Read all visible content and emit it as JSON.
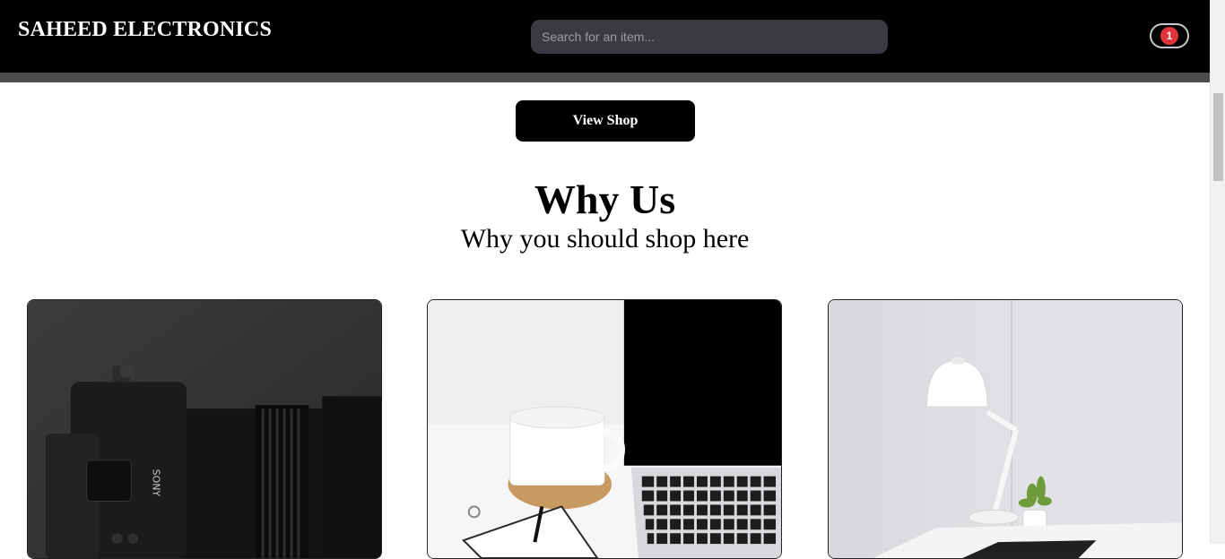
{
  "header": {
    "brand": "SAHEED ELECTRONICS",
    "search_placeholder": "Search for an item...",
    "cart_count": "1"
  },
  "hero": {
    "cta_label": "View Shop"
  },
  "why_us": {
    "title": "Why Us",
    "subtitle": "Why you should shop here"
  },
  "colors": {
    "nav_bg": "#000000",
    "badge": "#e2323a",
    "search_bg": "#3a3b40"
  },
  "cards": [
    {
      "image": "camera-photo"
    },
    {
      "image": "desk-laptop-mug-photo"
    },
    {
      "image": "desk-lamp-plant-photo"
    }
  ]
}
